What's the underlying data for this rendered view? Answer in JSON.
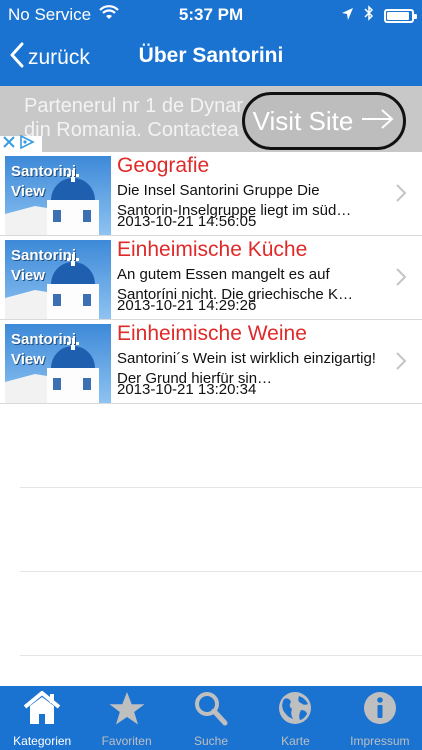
{
  "status_bar": {
    "carrier": "No Service",
    "time": "5:37 PM",
    "battery_level": 0.9
  },
  "nav": {
    "back_label": "zurück",
    "title": "Über Santorini"
  },
  "ad": {
    "line1": "Partenerul nr 1 de Dynar",
    "line2": "din Romania. Contactea",
    "button_label": "Visit Site"
  },
  "thumbnail_text": "Santorini\nView",
  "articles": [
    {
      "title": "Geografie",
      "description": "Die Insel Santorini Gruppe Die Santorin-Inselgruppe liegt im süd…",
      "date": "2013-10-21 14:56:05"
    },
    {
      "title": "Einheimische Küche",
      "description": "An gutem Essen mangelt es auf Santoríni nicht. Die griechische K…",
      "date": "2013-10-21 14:29:26"
    },
    {
      "title": "Einheimische Weine",
      "description": "Santorini´s Wein ist wirklich einzigartig! Der Grund hierfür sin…",
      "date": "2013-10-21 13:20:34"
    }
  ],
  "tabs": [
    {
      "label": "Kategorien",
      "icon": "home-icon",
      "active": true
    },
    {
      "label": "Favoriten",
      "icon": "star-icon",
      "active": false
    },
    {
      "label": "Suche",
      "icon": "search-icon",
      "active": false
    },
    {
      "label": "Karte",
      "icon": "globe-icon",
      "active": false
    },
    {
      "label": "Impressum",
      "icon": "info-icon",
      "active": false
    }
  ],
  "colors": {
    "brand_blue": "#1a73d1",
    "title_red": "#e02a2a",
    "inactive_tab": "#bfbfbf"
  }
}
